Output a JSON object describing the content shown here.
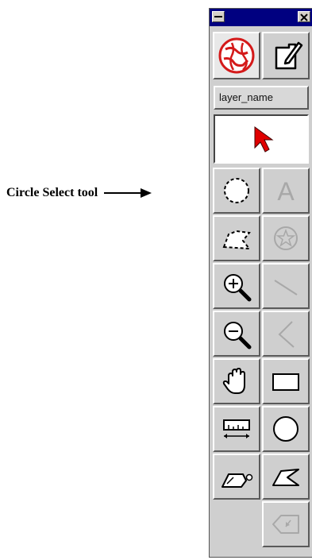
{
  "callout": {
    "text": "Circle Select tool",
    "points_to": "circle-select-tool"
  },
  "window": {
    "titlebar_color": "#000080",
    "close_glyph": "✕"
  },
  "mode_buttons": [
    {
      "icon": "globe-icon",
      "state": "active",
      "accent": "#d41a1a"
    },
    {
      "icon": "edit-document-icon",
      "state": "normal"
    }
  ],
  "layer_name": "layer_name",
  "current_tool_icon": "pointer-arrow-icon",
  "pointer_color": "#e00000",
  "tools": [
    {
      "icon": "circle-select-icon",
      "enabled": true
    },
    {
      "icon": "text-icon",
      "label": "A",
      "enabled": false
    },
    {
      "icon": "polygon-select-icon",
      "enabled": true
    },
    {
      "icon": "star-circle-icon",
      "enabled": false
    },
    {
      "icon": "zoom-in-icon",
      "enabled": true
    },
    {
      "icon": "line-icon",
      "enabled": false
    },
    {
      "icon": "zoom-out-icon",
      "enabled": true
    },
    {
      "icon": "polyline-icon",
      "enabled": false
    },
    {
      "icon": "hand-pan-icon",
      "enabled": true
    },
    {
      "icon": "rectangle-icon",
      "enabled": true
    },
    {
      "icon": "measure-ruler-icon",
      "enabled": true
    },
    {
      "icon": "circle-draw-icon",
      "enabled": true
    },
    {
      "icon": "eraser-icon",
      "enabled": true
    },
    {
      "icon": "polygon-draw-icon",
      "enabled": true
    },
    {
      "icon": "delete-vertex-icon",
      "enabled": false
    }
  ]
}
